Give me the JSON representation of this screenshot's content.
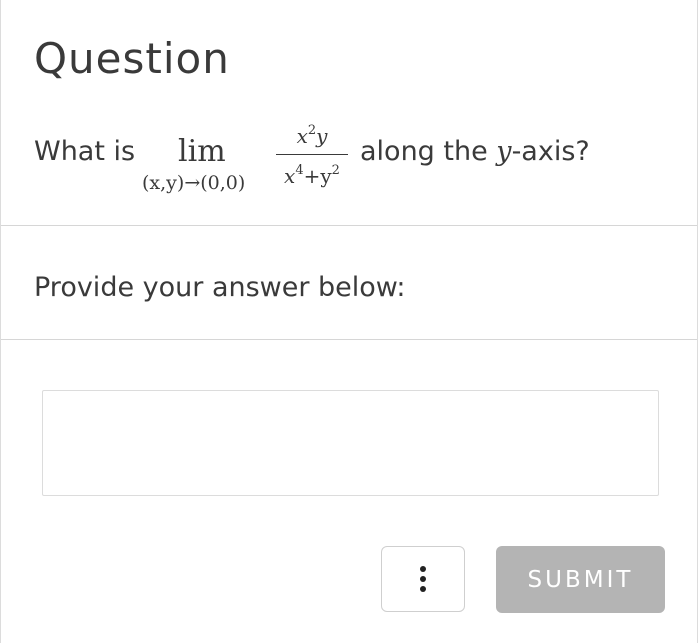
{
  "question": {
    "heading": "Question",
    "prefix": "What is",
    "limit": {
      "operator": "lim",
      "subscript": "(x,y)→(0,0)",
      "numerator_base": "x",
      "numerator_exp": "2",
      "numerator_tail": "y",
      "denominator_base1": "x",
      "denominator_exp1": "4",
      "denominator_mid": "+y",
      "denominator_exp2": "2"
    },
    "suffix_before": "along the ",
    "suffix_var": "y",
    "suffix_after": "-axis?"
  },
  "prompt": {
    "text": "Provide your answer below:"
  },
  "answer": {
    "value": "",
    "placeholder": ""
  },
  "actions": {
    "more_icon": "vertical-ellipsis-icon",
    "submit_label": "SUBMIT",
    "submit_color": "#b4b4b4"
  }
}
